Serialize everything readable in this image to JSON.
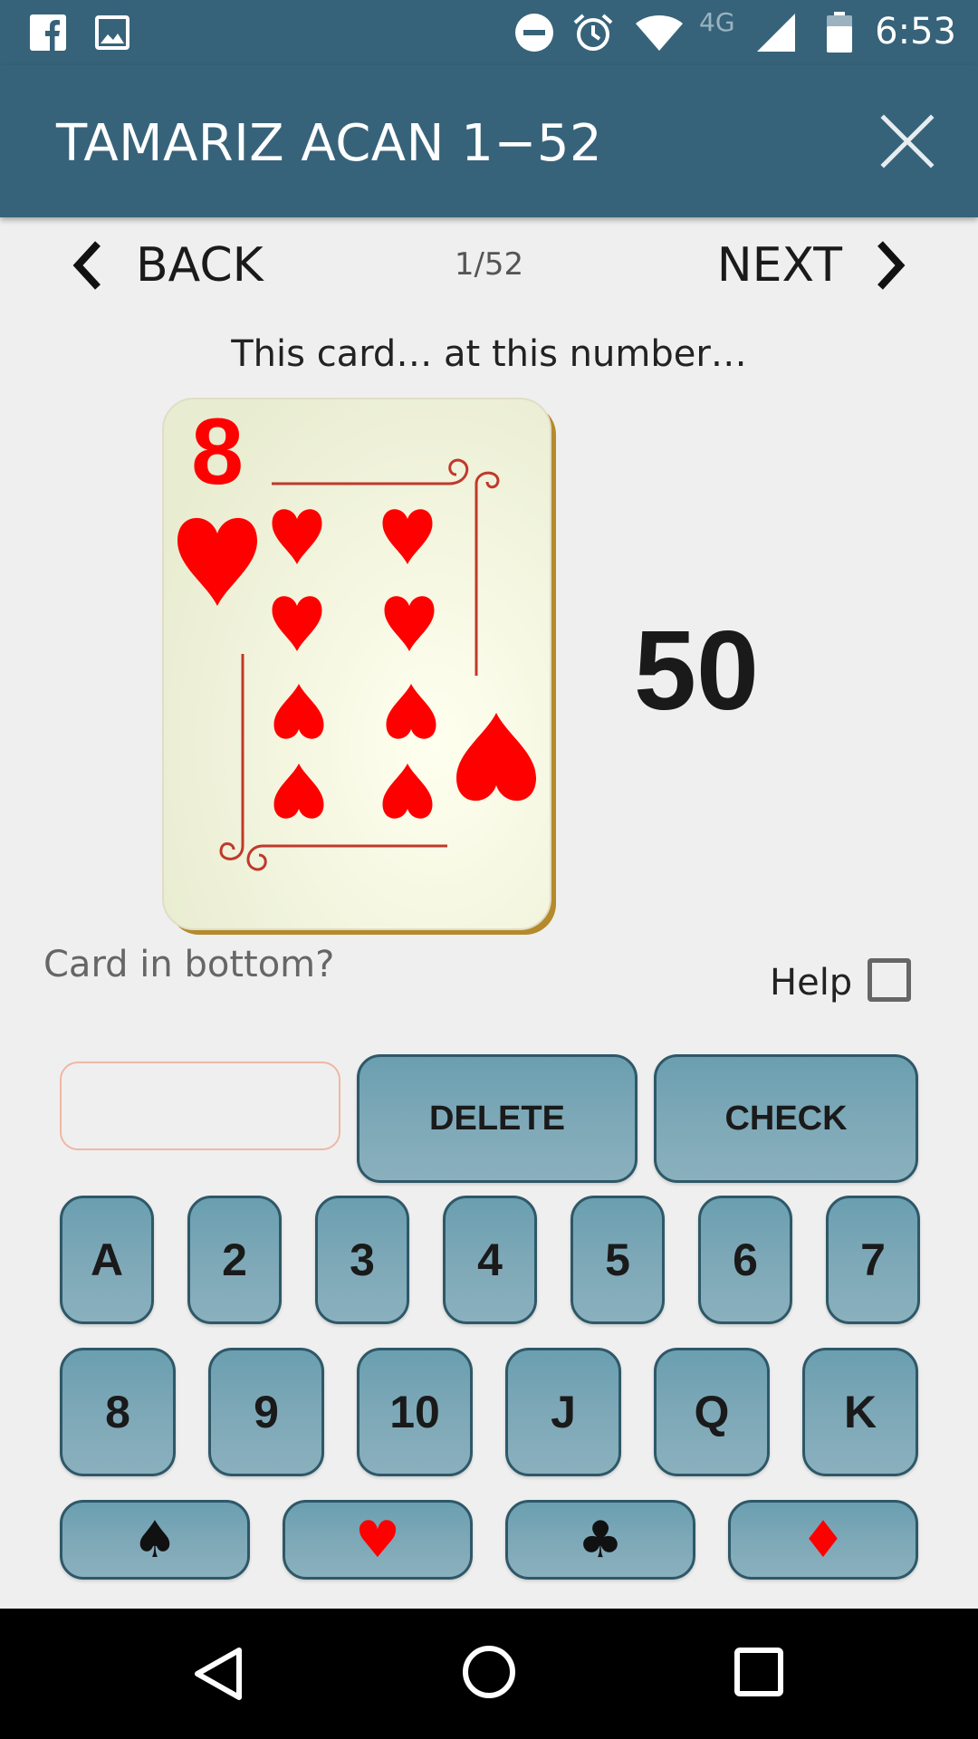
{
  "status_bar": {
    "time": "6:53",
    "network": "4G",
    "left_icons": [
      "facebook-icon",
      "image-icon"
    ],
    "right_icons": [
      "do-not-disturb-icon",
      "alarm-icon",
      "wifi-icon",
      "signal-icon",
      "battery-icon"
    ]
  },
  "app_bar": {
    "title": "TAMARIZ ACAN 1−52",
    "close_icon": "close-icon",
    "color": "#37637a"
  },
  "nav": {
    "back_label": "BACK",
    "next_label": "NEXT",
    "page": "1/52"
  },
  "prompt": "This card…  at this number…",
  "card": {
    "rank": "8",
    "suit": "hearts",
    "suit_color": "#ff0000"
  },
  "number": "50",
  "bottom_question": "Card in bottom?",
  "help": {
    "label": "Help",
    "checked": false
  },
  "input": {
    "value": "",
    "placeholder": ""
  },
  "actions": {
    "delete_label": "DELETE",
    "check_label": "CHECK"
  },
  "ranks_row1": [
    "A",
    "2",
    "3",
    "4",
    "5",
    "6",
    "7"
  ],
  "ranks_row2": [
    "8",
    "9",
    "10",
    "J",
    "Q",
    "K"
  ],
  "suits": [
    {
      "name": "spades",
      "glyph": "♠",
      "color": "#111111"
    },
    {
      "name": "hearts",
      "glyph": "♥",
      "color": "#ff0000"
    },
    {
      "name": "clubs",
      "glyph": "♣",
      "color": "#111111"
    },
    {
      "name": "diamonds",
      "glyph": "♦",
      "color": "#ff0000"
    }
  ],
  "key_colors": {
    "fill": "#7fa9b8",
    "border": "#2e5868"
  },
  "system_nav": [
    "back-icon",
    "home-icon",
    "recents-icon"
  ]
}
